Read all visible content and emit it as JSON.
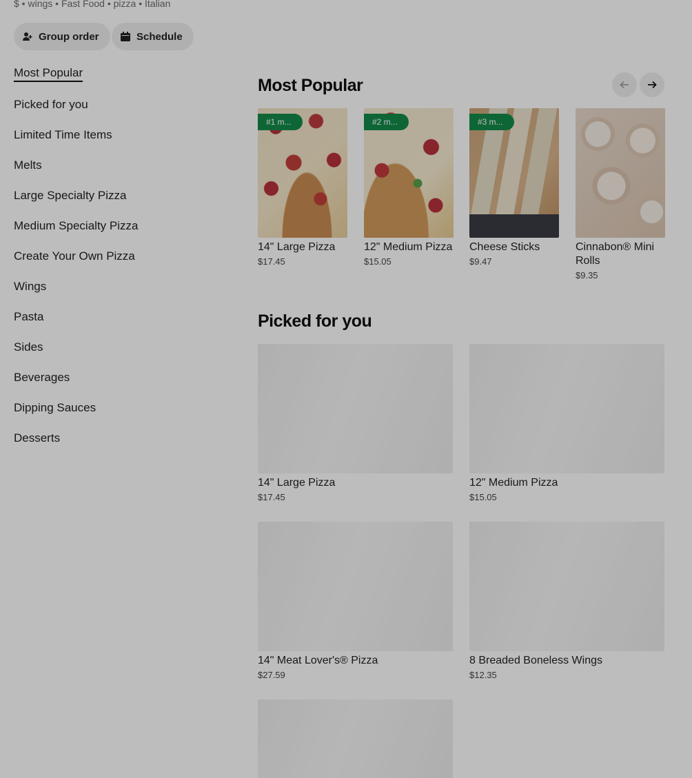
{
  "store": {
    "meta": "$ • wings • Fast Food • pizza • Italian",
    "group_order_label": "Group order",
    "schedule_label": "Schedule"
  },
  "sidebar": {
    "items": [
      {
        "label": "Most Popular",
        "active": true
      },
      {
        "label": "Picked for you"
      },
      {
        "label": "Limited Time Items"
      },
      {
        "label": "Melts"
      },
      {
        "label": "Large Specialty Pizza"
      },
      {
        "label": "Medium Specialty Pizza"
      },
      {
        "label": "Create Your Own Pizza"
      },
      {
        "label": "Wings"
      },
      {
        "label": "Pasta"
      },
      {
        "label": "Sides"
      },
      {
        "label": "Beverages"
      },
      {
        "label": "Dipping Sauces"
      },
      {
        "label": "Desserts"
      }
    ]
  },
  "most_popular": {
    "title": "Most Popular",
    "items": [
      {
        "badge": "#1 m...",
        "name": "14\" Large Pizza",
        "price": "$17.45"
      },
      {
        "badge": "#2 m...",
        "name": "12\" Medium Pizza",
        "price": "$15.05"
      },
      {
        "badge": "#3 m...",
        "name": "Cheese Sticks",
        "price": "$9.47"
      },
      {
        "badge": "",
        "name": "Cinnabon® Mini Rolls",
        "price": "$9.35"
      }
    ]
  },
  "picked_for_you": {
    "title": "Picked for you",
    "items": [
      {
        "name": "14\" Large Pizza",
        "price": "$17.45"
      },
      {
        "name": "12\" Medium Pizza",
        "price": "$15.05"
      },
      {
        "name": "14\" Meat Lover's® Pizza",
        "price": "$27.59"
      },
      {
        "name": "8 Breaded Boneless Wings",
        "price": "$12.35"
      },
      {
        "name": "",
        "price": ""
      }
    ]
  },
  "colors": {
    "badge": "#138a4a",
    "overlay": "rgba(0,0,0,0.26)"
  }
}
